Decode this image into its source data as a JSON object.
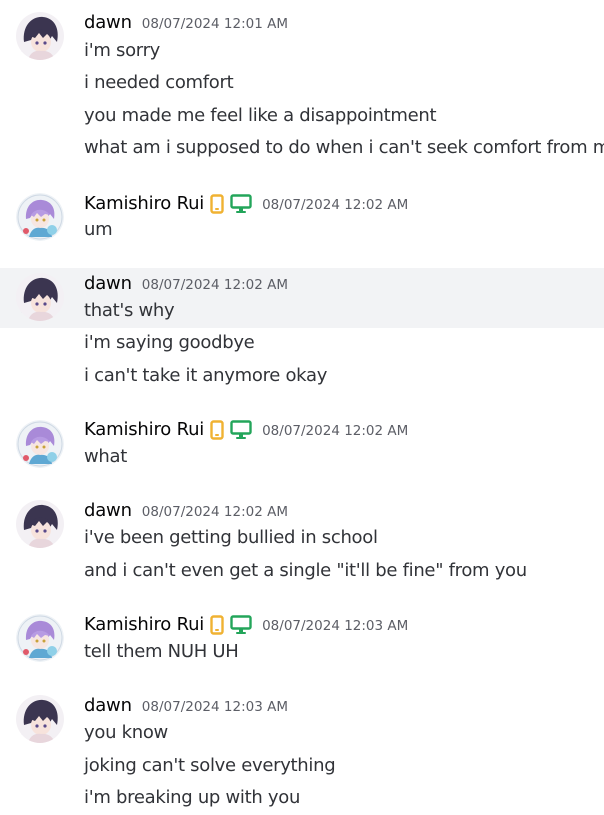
{
  "colors": {
    "mobile_badge": "#f0b232",
    "desktop_badge": "#23a55a",
    "hover_row": "#f2f3f5"
  },
  "icons": {
    "mobile": "mobile-phone-icon",
    "desktop": "desktop-monitor-icon"
  },
  "groups": [
    {
      "author": "dawn",
      "timestamp": "08/07/2024 12:01 AM",
      "lines": [
        "i'm sorry",
        "i needed comfort",
        "you made me feel like a disappointment",
        "what am i supposed to do when i can't seek comfort from my l"
      ]
    },
    {
      "author": "Kamishiro Rui",
      "timestamp": "08/07/2024 12:02 AM",
      "lines": [
        "um"
      ]
    },
    {
      "author": "dawn",
      "timestamp": "08/07/2024 12:02 AM",
      "lines": [
        "that's why",
        "i'm saying goodbye",
        "i can't take it anymore okay"
      ]
    },
    {
      "author": "Kamishiro Rui",
      "timestamp": "08/07/2024 12:02 AM",
      "lines": [
        "what"
      ]
    },
    {
      "author": "dawn",
      "timestamp": "08/07/2024 12:02 AM",
      "lines": [
        "i've been getting bullied in school",
        "and i can't even get a single \"it'll be fine\" from you"
      ]
    },
    {
      "author": "Kamishiro Rui",
      "timestamp": "08/07/2024 12:03 AM",
      "lines": [
        "tell them NUH UH"
      ]
    },
    {
      "author": "dawn",
      "timestamp": "08/07/2024 12:03 AM",
      "lines": [
        "you know",
        "joking can't solve everything",
        "i'm breaking up with you"
      ]
    }
  ]
}
